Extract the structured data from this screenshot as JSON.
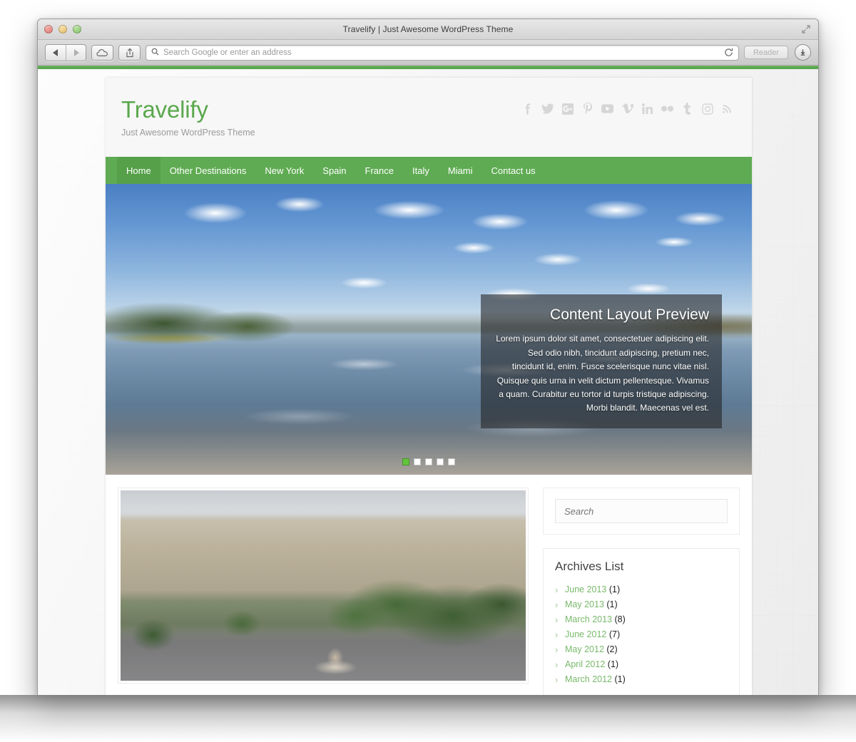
{
  "browser": {
    "window_title": "Travelify | Just Awesome WordPress Theme",
    "address_placeholder": "Search Google or enter an address",
    "reader_label": "Reader",
    "traffic_lights": [
      "close",
      "minimize",
      "maximize"
    ],
    "icons": {
      "back": "back-arrow-icon",
      "forward": "forward-arrow-icon",
      "cloud": "icloud-icon",
      "share": "share-icon",
      "search": "search-icon",
      "reload": "reload-icon",
      "download": "download-icon",
      "fullscreen": "fullscreen-icon"
    },
    "accent_color": "#5ba84f"
  },
  "site": {
    "brand": {
      "title": "Travelify",
      "tagline": "Just Awesome WordPress Theme",
      "title_color": "#5aa84d"
    },
    "social_icons": [
      {
        "name": "facebook-icon"
      },
      {
        "name": "twitter-icon"
      },
      {
        "name": "google-plus-icon"
      },
      {
        "name": "pinterest-icon"
      },
      {
        "name": "youtube-icon"
      },
      {
        "name": "vimeo-icon"
      },
      {
        "name": "linkedin-icon"
      },
      {
        "name": "flickr-icon"
      },
      {
        "name": "tumblr-icon"
      },
      {
        "name": "instagram-icon"
      },
      {
        "name": "rss-icon"
      }
    ],
    "nav": {
      "items": [
        {
          "label": "Home",
          "active": true
        },
        {
          "label": "Other Destinations",
          "active": false
        },
        {
          "label": "New York",
          "active": false
        },
        {
          "label": "Spain",
          "active": false
        },
        {
          "label": "France",
          "active": false
        },
        {
          "label": "Italy",
          "active": false
        },
        {
          "label": "Miami",
          "active": false
        },
        {
          "label": "Contact us",
          "active": false
        }
      ],
      "background_color": "#5fab53",
      "active_color": "#55a049"
    },
    "slider": {
      "image_alt": "Panoramic lake with blue sky, clouds and reflections",
      "caption_title": "Content Layout Preview",
      "caption_text": "Lorem ipsum dolor sit amet, consectetuer adipiscing elit. Sed odio nibh, tincidunt adipiscing, pretium nec, tincidunt id, enim. Fusce scelerisque nunc vitae nisl. Quisque quis urna in velit dictum pellentesque. Vivamus a quam. Curabitur eu tortor id turpis tristique adipiscing. Morbi blandit. Maecenas vel est.",
      "dots": [
        {
          "active": true
        },
        {
          "active": false
        },
        {
          "active": false
        },
        {
          "active": false
        },
        {
          "active": false
        }
      ],
      "active_dot_color": "#62c43c"
    },
    "main_content": {
      "post_image_alt": "Aerial view of Plaza de Cibeles, Madrid with traffic and fountain"
    },
    "sidebar": {
      "search": {
        "placeholder": "Search",
        "value": ""
      },
      "archives_widget": {
        "title": "Archives List",
        "items": [
          {
            "label": "June 2013",
            "count": "(1)"
          },
          {
            "label": "May 2013",
            "count": "(1)"
          },
          {
            "label": "March 2013",
            "count": "(8)"
          },
          {
            "label": "June 2012",
            "count": "(7)"
          },
          {
            "label": "May 2012",
            "count": "(2)"
          },
          {
            "label": "April 2012",
            "count": "(1)"
          },
          {
            "label": "March 2012",
            "count": "(1)"
          }
        ],
        "link_color": "#79b96b"
      }
    }
  }
}
